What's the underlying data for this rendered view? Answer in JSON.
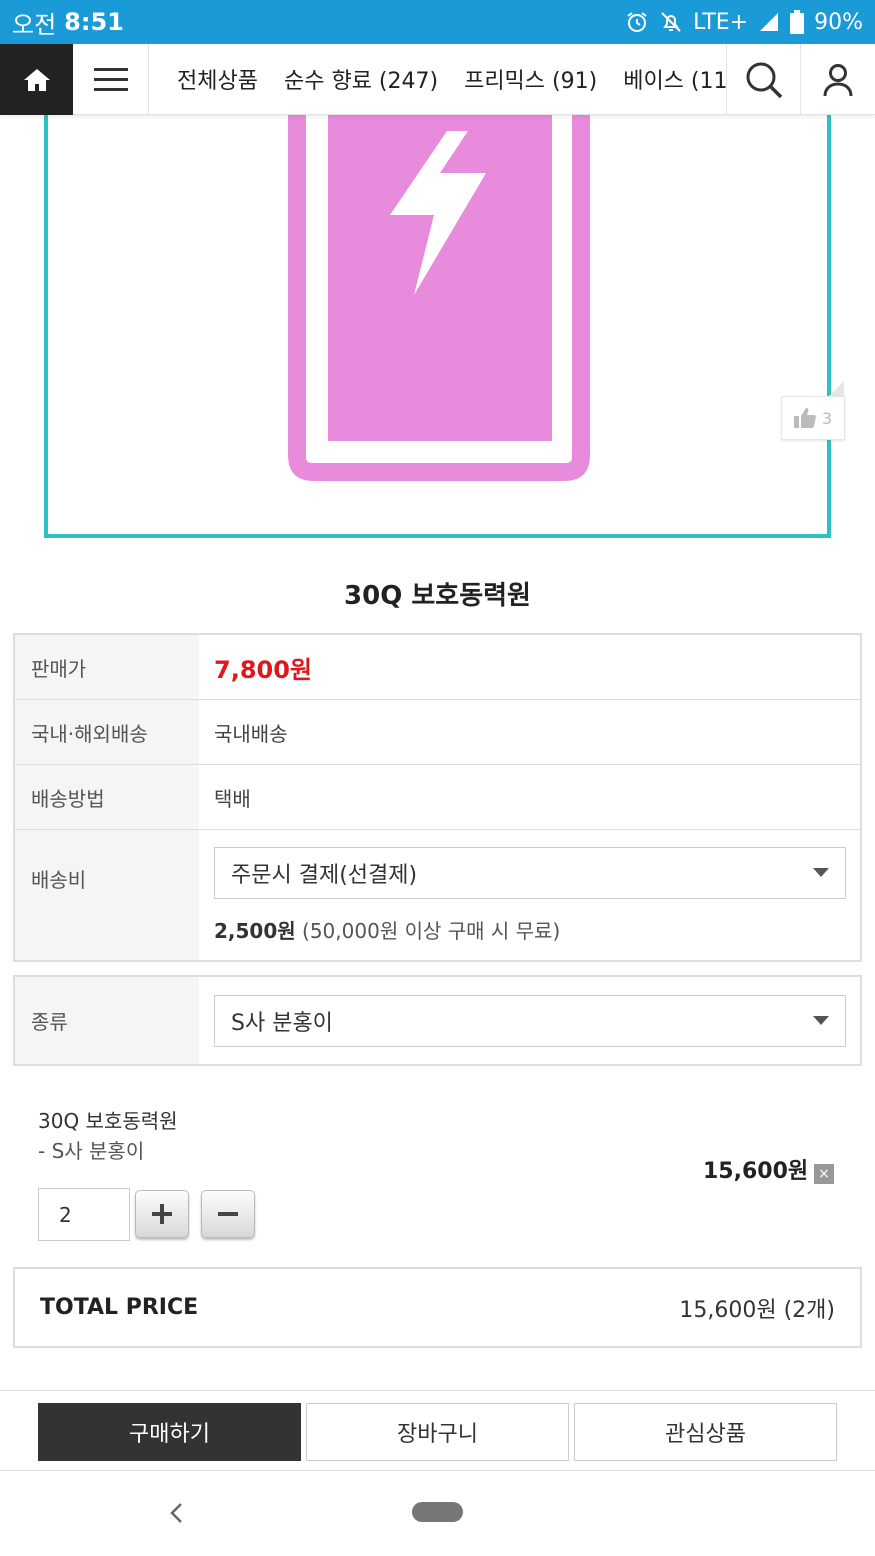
{
  "status_bar": {
    "ampm": "오전",
    "time": "8:51",
    "network": "LTE+",
    "battery": "90%"
  },
  "nav": {
    "categories": [
      "전체상품",
      "순수 향료 (247)",
      "프리믹스 (91)",
      "베이스 (11"
    ]
  },
  "product": {
    "like_count": "3",
    "title": "30Q 보호동력원",
    "image_colors": {
      "battery": "#e98bdc",
      "frame": "#2ec1c4"
    }
  },
  "info": {
    "price_label": "판매가",
    "price_value": "7,800원",
    "shipping_region_label": "국내·해외배송",
    "shipping_region_value": "국내배송",
    "shipping_method_label": "배송방법",
    "shipping_method_value": "택배",
    "shipping_fee_label": "배송비",
    "shipping_fee_select": "주문시 결제(선결제)",
    "shipping_fee_amount": "2,500원",
    "shipping_fee_note": "(50,000원 이상 구매 시 무료)"
  },
  "option": {
    "label": "종류",
    "selected": "S사 분홍이"
  },
  "selected_item": {
    "name": "30Q 보호동력원",
    "option": "- S사 분홍이",
    "price": "15,600원",
    "quantity": "2",
    "delete_symbol": "×"
  },
  "total": {
    "label": "TOTAL PRICE",
    "value": "15,600원 (2개)"
  },
  "actions": {
    "buy": "구매하기",
    "cart": "장바구니",
    "wish": "관심상품"
  },
  "colors": {
    "accent_red": "#e0161e",
    "status_bar": "#1a9bd7"
  }
}
